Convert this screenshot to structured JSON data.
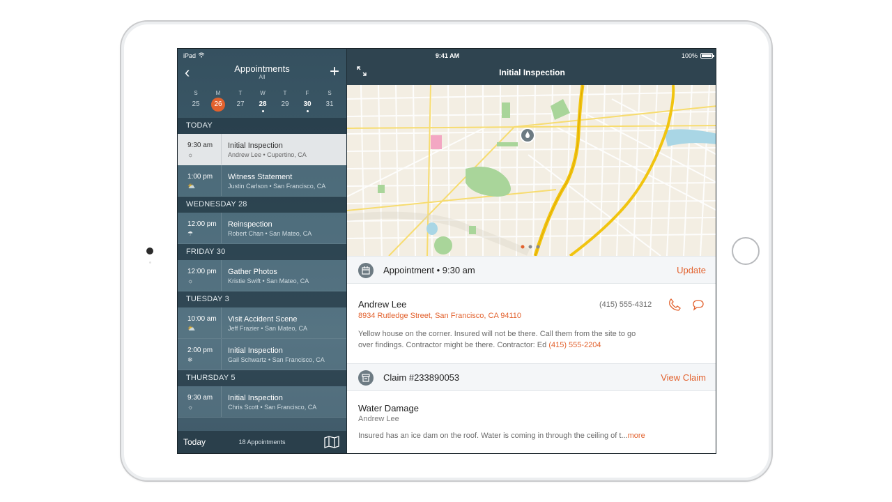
{
  "status_bar": {
    "device": "iPad",
    "time": "9:41 AM",
    "battery": "100%",
    "battery_level": 1.0
  },
  "sidebar": {
    "title": "Appointments",
    "subtitle": "All",
    "week": [
      {
        "letter": "S",
        "num": "25"
      },
      {
        "letter": "M",
        "num": "26",
        "selected": true
      },
      {
        "letter": "T",
        "num": "27"
      },
      {
        "letter": "W",
        "num": "28",
        "has_event": true
      },
      {
        "letter": "T",
        "num": "29"
      },
      {
        "letter": "F",
        "num": "30",
        "has_event": true
      },
      {
        "letter": "S",
        "num": "31"
      }
    ],
    "sections": [
      {
        "label": "TODAY",
        "items": [
          {
            "time": "9:30 am",
            "weather": "sunny",
            "title": "Initial Inspection",
            "sub": "Andrew Lee • Cupertino, CA",
            "active": true
          },
          {
            "time": "1:00 pm",
            "weather": "partly-cloudy",
            "title": "Witness Statement",
            "sub": "Justin Carlson • San Francisco, CA"
          }
        ]
      },
      {
        "label": "WEDNESDAY 28",
        "items": [
          {
            "time": "12:00 pm",
            "weather": "rainy",
            "title": "Reinspection",
            "sub": "Robert Chan • San Mateo, CA"
          }
        ]
      },
      {
        "label": "FRIDAY 30",
        "items": [
          {
            "time": "12:00 pm",
            "weather": "sunny",
            "title": "Gather Photos",
            "sub": "Kristie Swift • San Mateo, CA"
          }
        ]
      },
      {
        "label": "TUESDAY 3",
        "items": [
          {
            "time": "10:00 am",
            "weather": "partly-cloudy",
            "title": "Visit Accident Scene",
            "sub": "Jeff Frazier • San Mateo, CA"
          },
          {
            "time": "2:00 pm",
            "weather": "snow",
            "title": "Initial Inspection",
            "sub": "Gail Schwartz • San Francisco, CA"
          }
        ]
      },
      {
        "label": "THURSDAY 5",
        "items": [
          {
            "time": "9:30 am",
            "weather": "sunny",
            "title": "Initial Inspection",
            "sub": "Chris Scott • San Francisco, CA"
          }
        ]
      }
    ],
    "footer": {
      "today_label": "Today",
      "count": "18 Appointments"
    }
  },
  "detail": {
    "title": "Initial Inspection",
    "appointment": {
      "label": "Appointment • 9:30 am",
      "action": "Update"
    },
    "contact": {
      "name": "Andrew Lee",
      "address": "8934 Rutledge Street, San Francisco, CA 94110",
      "phone": "(415) 555-4312",
      "notes": "Yellow house on the corner. Insured will not be there. Call them from the site to go over findings.  Contractor might be there.  Contractor: Ed ",
      "notes_link": "(415) 555-2204"
    },
    "claim": {
      "label": "Claim #233890053",
      "action": "View Claim"
    },
    "claim_detail": {
      "type": "Water Damage",
      "person": "Andrew Lee",
      "description": "Insured has an ice dam on the roof.  Water is coming in through the ceiling of t...",
      "more": "more"
    }
  },
  "colors": {
    "accent": "#e2612d",
    "header": "#2f4450"
  }
}
